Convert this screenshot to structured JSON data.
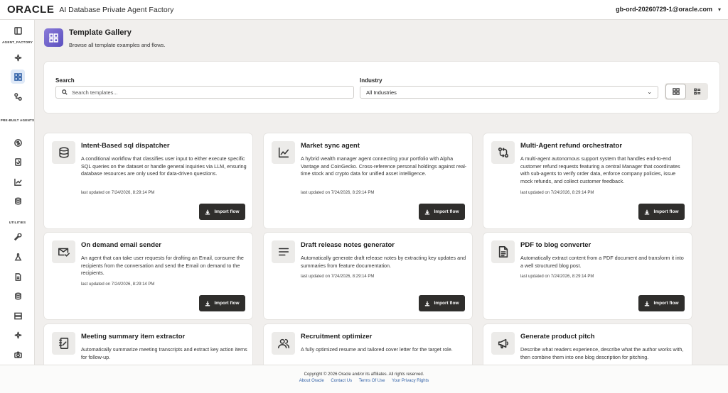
{
  "header": {
    "logo": "ORACLE",
    "app_title": "AI Database Private Agent Factory",
    "user": "gb-ord-20260729-1@oracle.com"
  },
  "sidebar": {
    "sections": [
      {
        "label": "AGENT_FACTORY",
        "items": [
          "sparkle-icon",
          "grid-icon",
          "flow-icon"
        ],
        "active": "grid-icon"
      },
      {
        "label": "PRE-BUILT AGENTS",
        "items": [
          "dollar-icon",
          "refresh-icon",
          "chart-icon",
          "database-icon"
        ]
      },
      {
        "label": "UTILITIES",
        "items": [
          "wrench-icon",
          "flask-icon",
          "document-icon",
          "database-icon",
          "server-icon",
          "sparkle-icon",
          "camera-icon"
        ]
      }
    ],
    "labels": {
      "agent_factory": "AGENT_FACTORY",
      "prebuilt": "PRE-BUILT AGENTS",
      "utilities": "UTILITIES"
    }
  },
  "page": {
    "title": "Template Gallery",
    "subtitle": "Browse all template examples and flows."
  },
  "filters": {
    "search_label": "Search",
    "search_placeholder": "Search templates...",
    "search_value": "",
    "industry_label": "Industry",
    "industry_value": "All Industries"
  },
  "view_mode": "grid",
  "cards": [
    {
      "title": "Intent-Based sql dispatcher",
      "icon": "database-icon",
      "description": "A conditional workflow that classifies user input to either execute specific SQL queries on the dataset or handle general inquiries via LLM, ensuring database resources are only used for data-driven questions.",
      "updated": "last updated on 7/24/2026, 8:29:14 PM",
      "button": "Import flow"
    },
    {
      "title": "Market sync agent",
      "icon": "chart-line-icon",
      "description": "A hybrid wealth manager agent connecting your portfolio with Alpha Vantage and CoinGecko. Cross-reference personal holdings against real-time stock and crypto data for unified asset intelligence.",
      "updated": "last updated on 7/24/2026, 8:29:14 PM",
      "button": "Import flow"
    },
    {
      "title": "Multi-Agent refund orchestrator",
      "icon": "refresh-arrows-icon",
      "description": "A multi-agent autonomous support system that handles end-to-end customer refund requests featuring a central Manager that coordinates with sub-agents to verify order data, enforce company policies, issue mock refunds, and collect customer feedback.",
      "updated": "last updated on 7/24/2026, 8:29:14 PM",
      "button": "Import flow"
    },
    {
      "title": "On demand email sender",
      "icon": "mail-check-icon",
      "description": "An agent that can take user requests for drafting an Email, consume the recipients from the conversation and send the Email on demand to the recipients.",
      "updated": "last updated on 7/24/2026, 8:29:14 PM",
      "button": "Import flow"
    },
    {
      "title": "Draft release notes generator",
      "icon": "lines-icon",
      "description": "Automatically generate draft release notes by extracting key updates and summaries from feature documentation.",
      "updated": "last updated on 7/24/2026, 8:29:14 PM",
      "button": "Import flow"
    },
    {
      "title": "PDF to blog converter",
      "icon": "document-icon",
      "description": "Automatically extract content from a PDF document and transform it into a well structured blog post.",
      "updated": "last updated on 7/24/2026, 8:29:14 PM",
      "button": "Import flow"
    },
    {
      "title": "Meeting summary item extractor",
      "icon": "notebook-icon",
      "description": "Automatically summarize meeting transcripts and extract key action items for follow-up.",
      "updated": "",
      "button": ""
    },
    {
      "title": "Recruitment optimizer",
      "icon": "users-icon",
      "description": "A fully optimized resume and tailored cover letter for the target role.",
      "updated": "",
      "button": ""
    },
    {
      "title": "Generate product pitch",
      "icon": "megaphone-icon",
      "description": "Describe what readers experience, describe what the author works with, then combine them into one blog description for pitching.",
      "updated": "",
      "button": ""
    }
  ],
  "footer": {
    "copyright": "Copyright © 2026 Oracle and/or its affiliates. All rights reserved.",
    "links": [
      "About Oracle",
      "Contact Us",
      "Terms Of Use",
      "Your Privacy Rights"
    ]
  }
}
